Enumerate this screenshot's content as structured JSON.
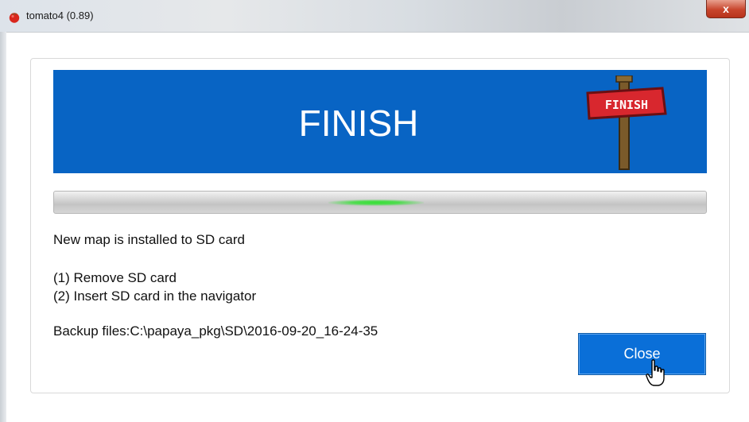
{
  "window": {
    "title": "tomato4 (0.89)",
    "close_glyph": "x",
    "icon": "tomato-icon"
  },
  "banner": {
    "title": "FINISH",
    "sign_text": "FINISH",
    "bg_color": "#0864c4"
  },
  "progress": {
    "state": "indeterminate"
  },
  "messages": {
    "installed": "New map is installed to SD card",
    "step1": "(1) Remove SD card",
    "step2": "(2) Insert SD card in the navigator",
    "backup": "Backup files:C:\\papaya_pkg\\SD\\2016-09-20_16-24-35"
  },
  "buttons": {
    "close_label": "Close"
  },
  "colors": {
    "accent": "#0a6fd8",
    "progress_glow": "#34e034"
  }
}
